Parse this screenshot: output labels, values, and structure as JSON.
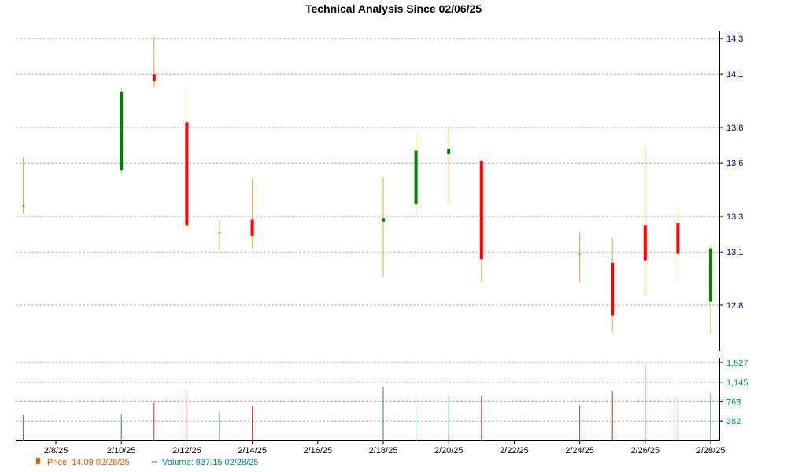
{
  "chart_data": {
    "type": "candlestick",
    "title": "Technical Analysis Since 02/06/25",
    "price_axis": {
      "ticks": [
        "12.8",
        "13.1",
        "13.3",
        "13.6",
        "13.8",
        "14.1",
        "14.3"
      ],
      "range": [
        12.55,
        14.35
      ]
    },
    "volume_axis": {
      "ticks": [
        "382",
        "763",
        "1,145",
        "1,527"
      ],
      "range": [
        0,
        1527
      ]
    },
    "date_ticks": [
      "2/8/25",
      "2/10/25",
      "2/12/25",
      "2/14/25",
      "2/16/25",
      "2/18/25",
      "2/20/25",
      "2/22/25",
      "2/24/25",
      "2/26/25",
      "2/28/25"
    ],
    "candles": [
      {
        "date": "2/7/25",
        "open": 13.36,
        "high": 13.63,
        "low": 13.32,
        "close": 13.36,
        "volume": 500
      },
      {
        "date": "2/10/25",
        "open": 13.56,
        "high": 14.02,
        "low": 13.54,
        "close": 14.0,
        "volume": 520
      },
      {
        "date": "2/11/25",
        "open": 14.1,
        "high": 14.31,
        "low": 14.03,
        "close": 14.06,
        "volume": 750
      },
      {
        "date": "2/12/25",
        "open": 13.83,
        "high": 14.0,
        "low": 13.22,
        "close": 13.25,
        "volume": 960
      },
      {
        "date": "2/13/25",
        "open": 13.21,
        "high": 13.28,
        "low": 13.11,
        "close": 13.21,
        "volume": 550
      },
      {
        "date": "2/14/25",
        "open": 13.28,
        "high": 13.51,
        "low": 13.12,
        "close": 13.19,
        "volume": 680
      },
      {
        "date": "2/18/25",
        "open": 13.27,
        "high": 13.52,
        "low": 12.96,
        "close": 13.29,
        "volume": 1050
      },
      {
        "date": "2/19/25",
        "open": 13.37,
        "high": 13.76,
        "low": 13.32,
        "close": 13.67,
        "volume": 660
      },
      {
        "date": "2/20/25",
        "open": 13.65,
        "high": 13.8,
        "low": 13.38,
        "close": 13.68,
        "volume": 880
      },
      {
        "date": "2/21/25",
        "open": 13.61,
        "high": 13.62,
        "low": 12.93,
        "close": 13.06,
        "volume": 880
      },
      {
        "date": "2/24/25",
        "open": 13.09,
        "high": 13.21,
        "low": 12.93,
        "close": 13.09,
        "volume": 690
      },
      {
        "date": "2/25/25",
        "open": 13.04,
        "high": 13.18,
        "low": 12.65,
        "close": 12.74,
        "volume": 970
      },
      {
        "date": "2/26/25",
        "open": 13.25,
        "high": 13.7,
        "low": 12.86,
        "close": 13.05,
        "volume": 1480
      },
      {
        "date": "2/27/25",
        "open": 13.26,
        "high": 13.35,
        "low": 12.95,
        "close": 13.09,
        "volume": 860
      },
      {
        "date": "2/28/25",
        "open": 12.82,
        "high": 13.14,
        "low": 12.64,
        "close": 13.12,
        "volume": 937.15
      }
    ],
    "legend": {
      "price_text": "Price: 14.09  02/28/25",
      "volume_text": "Volume: 937.15  02/28/25"
    }
  },
  "colors": {
    "up": "#008000",
    "down": "#ff0000",
    "wick": "#e8a33c",
    "vol_up": "#2e8b57",
    "vol_down": "#cc3311",
    "grid": "#b0b0b0",
    "axis": "#000000"
  }
}
